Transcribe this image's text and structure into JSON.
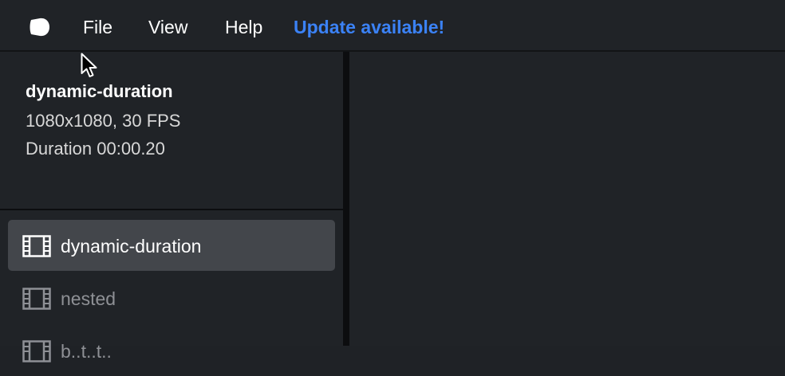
{
  "menubar": {
    "logo_icon": "motion-canvas-logo-icon",
    "items": [
      {
        "label": "File"
      },
      {
        "label": "View"
      },
      {
        "label": "Help"
      }
    ],
    "update_label": "Update available!",
    "update_color": "#3b82f6"
  },
  "project_info": {
    "name": "dynamic-duration",
    "resolution": "1080x1080, 30 FPS",
    "duration": "Duration 00:00.20"
  },
  "scenes": [
    {
      "label": "dynamic-duration",
      "icon": "film-icon",
      "active": true
    },
    {
      "label": "nested",
      "icon": "film-icon",
      "active": false
    },
    {
      "label": "b..t..t..",
      "icon": "film-icon",
      "active": false
    }
  ]
}
